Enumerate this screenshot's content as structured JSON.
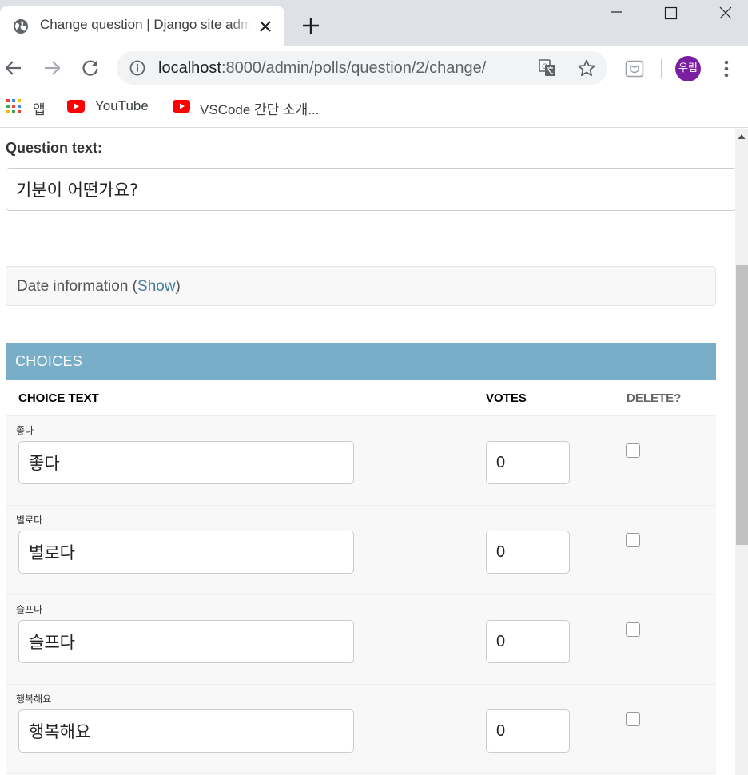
{
  "browser": {
    "tab_title": "Change question | Django site admin",
    "url_host": "localhost",
    "url_path": ":8000/admin/polls/question/2/change/",
    "profile_initials": "우림",
    "bookmarks": [
      {
        "label": "앱",
        "icon": "apps-grid-icon"
      },
      {
        "label": "YouTube",
        "icon": "youtube-icon"
      },
      {
        "label": "VSCode 간단 소개...",
        "icon": "youtube-icon"
      }
    ]
  },
  "form": {
    "question_label": "Question text:",
    "question_value": "기분이 어떤가요?",
    "date_section": {
      "title": "Date information (",
      "toggle": "Show",
      "close_paren": ")"
    }
  },
  "choices": {
    "heading": "CHOICES",
    "columns": {
      "text": "CHOICE TEXT",
      "votes": "VOTES",
      "delete": "DELETE?"
    },
    "rows": [
      {
        "label": "좋다",
        "text": "좋다",
        "votes": "0",
        "delete": false
      },
      {
        "label": "별로다",
        "text": "별로다",
        "votes": "0",
        "delete": false
      },
      {
        "label": "슬프다",
        "text": "슬프다",
        "votes": "0",
        "delete": false
      },
      {
        "label": "행복해요",
        "text": "행복해요",
        "votes": "0",
        "delete": false
      }
    ]
  },
  "colors": {
    "module_header": "#79aec8",
    "link": "#447e9b",
    "avatar": "#7b1fa2",
    "youtube_red": "#ff0000"
  }
}
